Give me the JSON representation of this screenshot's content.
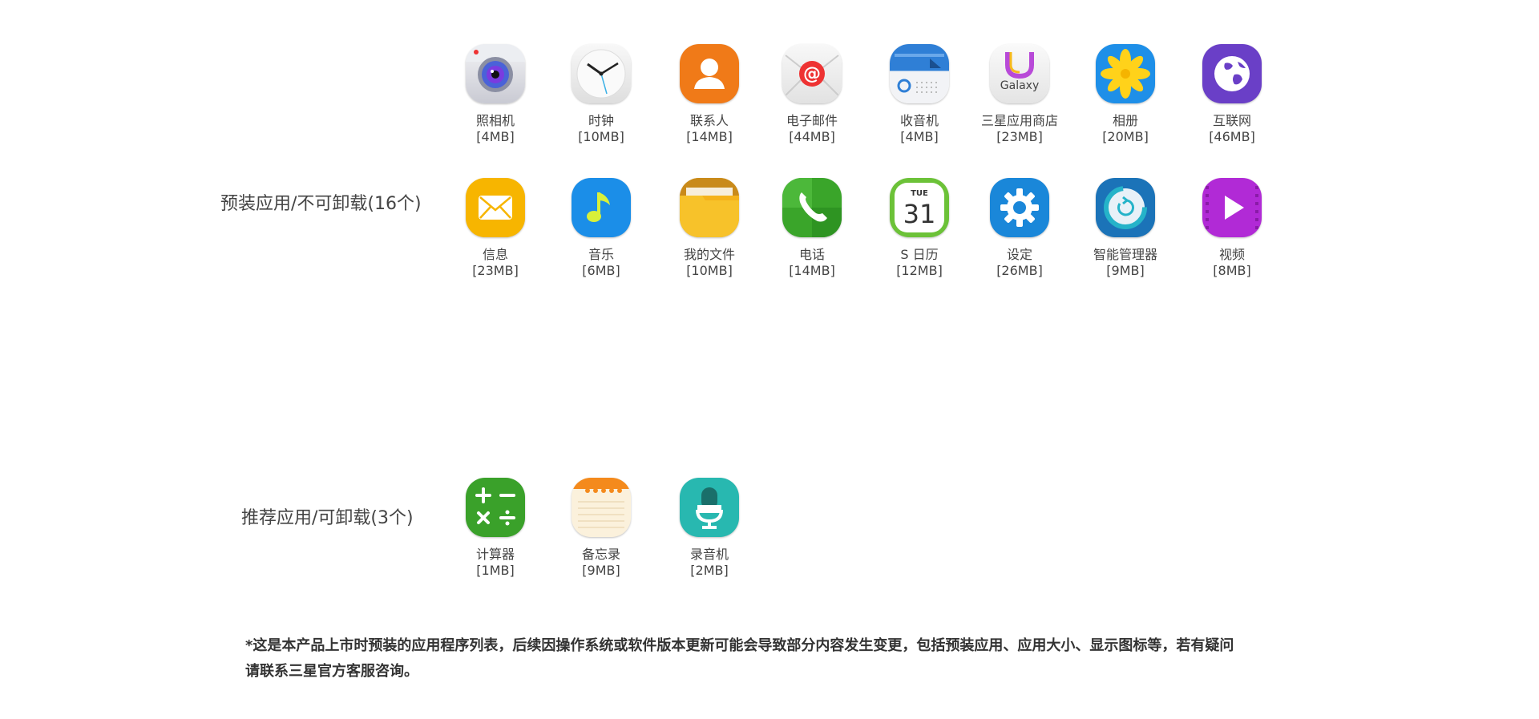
{
  "sections": {
    "preinstalled": {
      "label": "预装应用/不可卸载(16个)"
    },
    "recommended": {
      "label": "推荐应用/可卸载(3个)"
    }
  },
  "apps": [
    {
      "name": "照相机",
      "size": "[4MB]",
      "icon": "camera-icon"
    },
    {
      "name": "时钟",
      "size": "[10MB]",
      "icon": "clock-icon"
    },
    {
      "name": "联系人",
      "size": "[14MB]",
      "icon": "contacts-icon"
    },
    {
      "name": "电子邮件",
      "size": "[44MB]",
      "icon": "email-icon"
    },
    {
      "name": "收音机",
      "size": "[4MB]",
      "icon": "radio-icon"
    },
    {
      "name": "三星应用商店",
      "size": "[23MB]",
      "icon": "galaxy-store-icon",
      "icon_text": "Galaxy"
    },
    {
      "name": "相册",
      "size": "[20MB]",
      "icon": "gallery-icon"
    },
    {
      "name": "互联网",
      "size": "[46MB]",
      "icon": "internet-icon"
    },
    {
      "name": "信息",
      "size": "[23MB]",
      "icon": "messages-icon"
    },
    {
      "name": "音乐",
      "size": "[6MB]",
      "icon": "music-icon"
    },
    {
      "name": "我的文件",
      "size": "[10MB]",
      "icon": "my-files-icon"
    },
    {
      "name": "电话",
      "size": "[14MB]",
      "icon": "phone-icon"
    },
    {
      "name": "S 日历",
      "size": "[12MB]",
      "icon": "calendar-icon",
      "icon_day": "TUE",
      "icon_date": "31"
    },
    {
      "name": "设定",
      "size": "[26MB]",
      "icon": "settings-icon"
    },
    {
      "name": "智能管理器",
      "size": "[9MB]",
      "icon": "smart-manager-icon"
    },
    {
      "name": "视频",
      "size": "[8MB]",
      "icon": "video-icon"
    },
    {
      "name": "计算器",
      "size": "[1MB]",
      "icon": "calculator-icon"
    },
    {
      "name": "备忘录",
      "size": "[9MB]",
      "icon": "memo-icon"
    },
    {
      "name": "录音机",
      "size": "[2MB]",
      "icon": "voice-recorder-icon"
    }
  ],
  "footnote": {
    "line1": "*这是本产品上市时预装的应用程序列表，后续因操作系统或软件版本更新可能会导致部分内容发生变更，包括预装应用、应用大小、显示图标等，若有疑问",
    "line2": "请联系三星官方客服咨询。"
  },
  "colors": {
    "contacts": "#f07a18",
    "email": "#e33",
    "gallery": "#1e8fe8",
    "internet": "#6a3fc7",
    "messages": "#f7b500",
    "music": "#1b8ee8",
    "files": "#f5b21b",
    "phone": "#3aa52a",
    "calendar": "#6cc238",
    "settings": "#1a87d9",
    "smart": "#1b73b8",
    "video": "#b12ad6",
    "calculator": "#3aa12a",
    "memo": "#f48a1c",
    "recorder": "#28b8b0"
  }
}
